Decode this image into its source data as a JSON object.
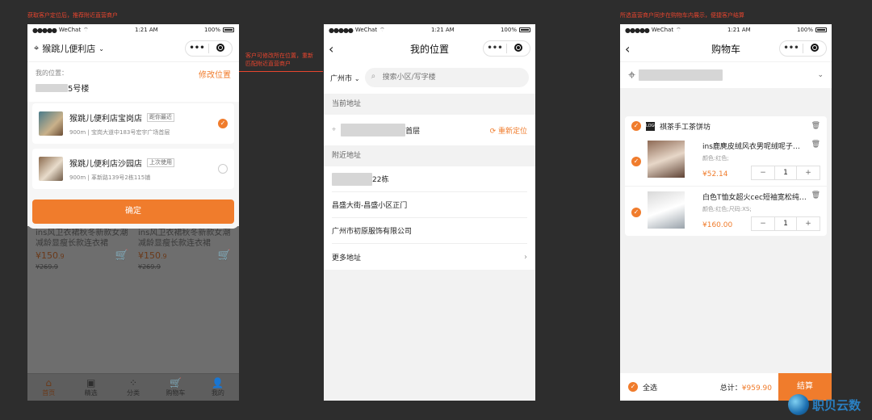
{
  "captions": {
    "c1": "获取客户定位后，推荐附近直营商户",
    "c2_line1": "客户可修改所在位置，重新",
    "c2_line2": "匹配附近直营商户",
    "c3": "所选直营商户同步在购物车内展示，便捷客户结算"
  },
  "status": {
    "carrier": "WeChat",
    "time": "1:21 AM",
    "battery": "100%"
  },
  "phone1": {
    "store_title": "猴跳儿便利店",
    "location_label": "我的位置：",
    "location_suffix": "5号楼",
    "edit_location": "修改位置",
    "stores": [
      {
        "name": "猴跳儿便利店宝岗店",
        "tag": "距你最近",
        "distance": "900m",
        "address": "宝岗大道中183号宏宇广场首层",
        "selected": true
      },
      {
        "name": "猴跳儿便利店沙园店",
        "tag": "上次使用",
        "distance": "900m",
        "address": "革新路139号2栋115铺",
        "selected": false
      }
    ],
    "confirm": "确定",
    "products": [
      {
        "title": "ins风卫衣裙秋冬新款女潮减龄显瘦长款连衣裙",
        "price": "¥150",
        "price_dec": ".9",
        "old": "¥269.9"
      },
      {
        "title": "ins风卫衣裙秋冬新款女潮减龄显瘦长款连衣裙",
        "price": "¥150",
        "price_dec": ".9",
        "old": "¥269.9"
      }
    ],
    "tabs": [
      "首页",
      "精选",
      "分类",
      "购物车",
      "我的"
    ]
  },
  "phone2": {
    "title": "我的位置",
    "city": "广州市",
    "search_placeholder": "搜索小区/写字楼",
    "current_header": "当前地址",
    "current_suffix": "首层",
    "relocate": "重新定位",
    "nearby_header": "附近地址",
    "nearby": [
      "22栋",
      "昌盛大街-昌盛小区正门",
      "广州市初原服饰有限公司",
      "更多地址"
    ]
  },
  "phone3": {
    "title": "购物车",
    "shop_name": "祺茶手工茶饼坊",
    "shop_logo": "LOGO",
    "items": [
      {
        "title": "ins鹿麂皮绒风衣男呢绒呢子…",
        "spec": "颜色:红色;",
        "price": "¥52.14",
        "qty": "1"
      },
      {
        "title": "白色T恤女超火cec短袖宽松纯…",
        "spec": "颜色:红色;尺码:XS;",
        "price": "¥160.00",
        "qty": "1"
      }
    ],
    "select_all": "全选",
    "total_label": "总计：",
    "total_value": "¥959.90",
    "checkout": "结算"
  },
  "watermark": "职贝云数"
}
